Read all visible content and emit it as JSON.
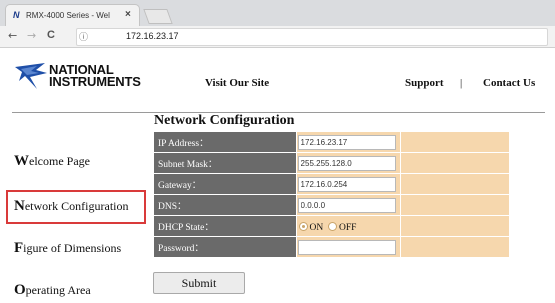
{
  "browser": {
    "tab_title": "RMX-4000 Series - Wel",
    "tab_close": "×",
    "url": "172.16.23.17",
    "info_symbol": "ⓘ",
    "nav": {
      "back": "←",
      "forward": "→",
      "reload": "C"
    }
  },
  "header": {
    "logo_line1": "NATIONAL",
    "logo_line2": "INSTRUMENTS",
    "links": {
      "visit": "Visit Our Site",
      "support": "Support",
      "separator": "|",
      "contact": "Contact Us"
    }
  },
  "sidebar": {
    "items": [
      {
        "cap": "W",
        "rest": "elcome Page"
      },
      {
        "cap": "N",
        "rest": "etwork Configuration"
      },
      {
        "cap": "F",
        "rest": "igure of Dimensions"
      },
      {
        "cap": "O",
        "rest": "perating Area"
      }
    ]
  },
  "form": {
    "title": "Network Configuration",
    "fields": {
      "ip": {
        "label": "IP Address：",
        "value": "172.16.23.17"
      },
      "subnet": {
        "label": "Subnet Mask：",
        "value": "255.255.128.0"
      },
      "gateway": {
        "label": "Gateway：",
        "value": "172.16.0.254"
      },
      "dns": {
        "label": "DNS：",
        "value": "0.0.0.0"
      },
      "dhcp": {
        "label": "DHCP State：",
        "on": "ON",
        "off": "OFF",
        "selected": "ON"
      },
      "password": {
        "label": "Password：",
        "value": ""
      }
    },
    "submit": "Submit"
  },
  "colors": {
    "label_bg": "#6a6a6a",
    "field_bg": "#f6d7ad",
    "highlight": "#d93a3a"
  }
}
